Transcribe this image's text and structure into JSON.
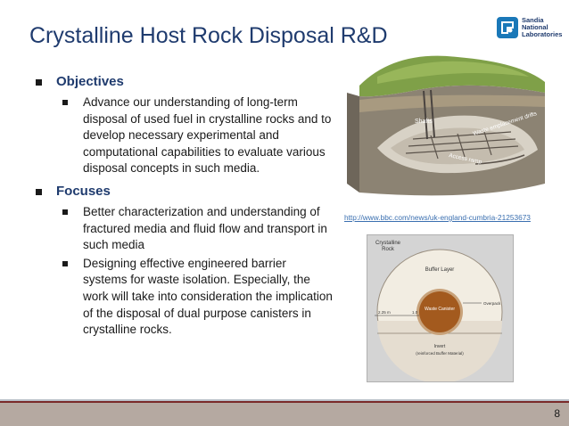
{
  "slide": {
    "title": "Crystalline Host Rock Disposal R&D",
    "page_number": "8"
  },
  "logo": {
    "text": "Sandia\nNational\nLaboratories"
  },
  "content": {
    "objectives_heading": "Objectives",
    "objectives_text": "Advance our understanding of long-term disposal of used fuel in crystalline rocks and to develop necessary experimental and computational capabilities to evaluate various disposal concepts in such media.",
    "focuses_heading": "Focuses",
    "focus_1": "Better characterization and understanding of fractured media and fluid flow and transport in such media",
    "focus_2": "Designing effective engineered barrier systems for waste isolation. Especially, the work will take into consideration the implication of the disposal of dual purpose canisters in crystalline rocks."
  },
  "figure": {
    "photo_labels": {
      "shafts": "Shafts",
      "drifts": "Waste emplacement drifts",
      "ramp": "Access ramp"
    },
    "link": "http://www.bbc.com/news/uk-england-cumbria-21253673",
    "diagram": {
      "rock": "Crystalline Rock",
      "buffer": "Buffer Layer",
      "canister": "Waste Canister",
      "overpack": "Overpack",
      "dim_outer": "2.25 m",
      "dim_inner": "1.0",
      "invert": "Invert",
      "invert_sub": "(reinforced Buffer Material)"
    }
  },
  "colors": {
    "title": "#1f3b6e",
    "footer": "#b5a9a1",
    "accent": "#7a2a2a"
  }
}
